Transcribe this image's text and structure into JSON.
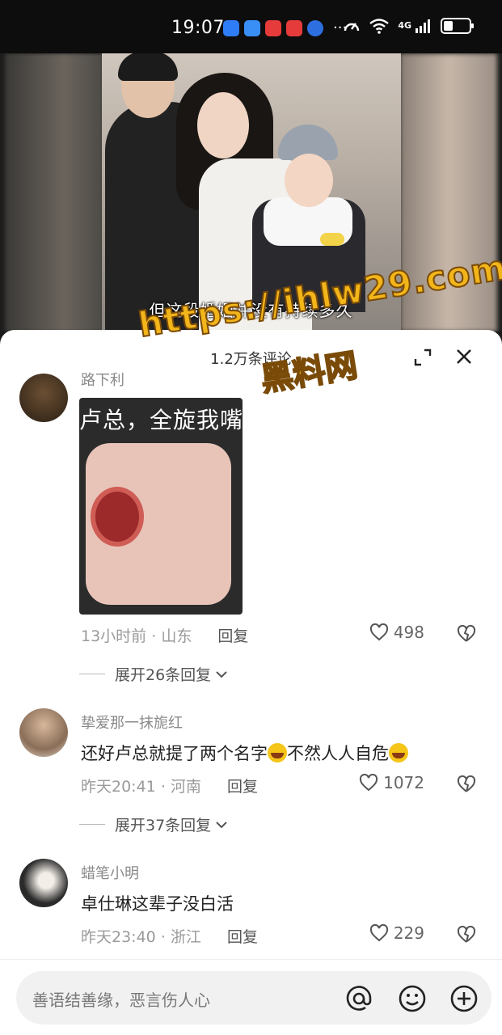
{
  "status_bar": {
    "time": "19:07",
    "more": "···",
    "network": "4G",
    "battery_level": 0.35
  },
  "video": {
    "subtitle": "但这段婚姻并没有持续多久"
  },
  "sheet": {
    "title": "1.2万条评论"
  },
  "watermark": {
    "url": "https://ihlw29.com",
    "name": "黑料网"
  },
  "comments": [
    {
      "username": "路下利",
      "meme_caption": "卢总，全旋我嘴",
      "time": "13小时前",
      "location": "山东",
      "reply_label": "回复",
      "likes": "498",
      "expand_label": "展开26条回复"
    },
    {
      "username": "挚爱那一抹旎红",
      "text_part1": "还好卢总就提了两个名字",
      "text_part2": "不然人人自危",
      "time": "昨天20:41",
      "location": "河南",
      "reply_label": "回复",
      "likes": "1072",
      "expand_label": "展开37条回复"
    },
    {
      "username": "蜡笔小明",
      "text": "卓仕琳这辈子没白活",
      "time": "昨天23:40",
      "location": "浙江",
      "reply_label": "回复",
      "likes": "229"
    }
  ],
  "input": {
    "placeholder": "善语结善缘，恶言伤人心"
  },
  "icons": {
    "mention": "at-icon",
    "emoji": "emoji-icon",
    "add": "plus-icon"
  }
}
